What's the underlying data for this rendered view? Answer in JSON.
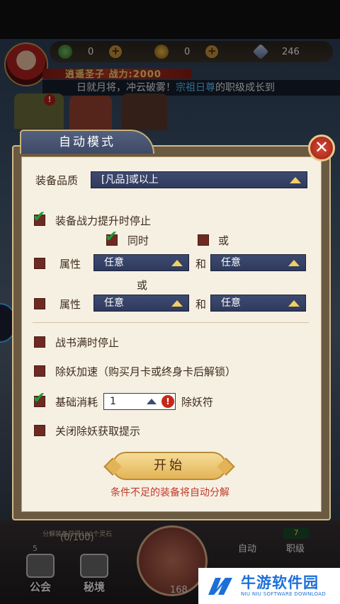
{
  "game": {
    "resources": [
      {
        "icon": "green-coin-icon",
        "value": "0"
      },
      {
        "icon": "gold-coin-icon",
        "value": "0"
      },
      {
        "icon": "crystal-icon",
        "value": "246"
      }
    ],
    "player_name": "逍遥圣子  战力:2000",
    "marquee_prefix": "日就月将，冲云破雾！",
    "marquee_highlight": "宗祖日尊",
    "marquee_suffix": "的职级成长到",
    "alert_badge": "!",
    "progress_label": "分解装备获得100个灵石",
    "progress_value": "(0/100)",
    "counter_5": "5",
    "circle_value": "168",
    "bottom_buttons": [
      {
        "label": "公会",
        "icon": "guild-icon"
      },
      {
        "label": "秘境",
        "icon": "secret-realm-icon"
      }
    ],
    "auto_label": "自动",
    "rank_label": "职级",
    "rank_badge": "7"
  },
  "dialog": {
    "title": "自动模式",
    "close_symbol": "✕",
    "quality_label": "装备品质",
    "quality_value": "[凡品]或以上",
    "stop_on_power": {
      "label": "装备战力提升时停止",
      "checked": true
    },
    "same_time": {
      "label": "同时",
      "checked": true
    },
    "or_option": {
      "label": "或",
      "checked": false
    },
    "attr_row1": {
      "label": "属性",
      "checked": false,
      "select1": "任意",
      "and": "和",
      "select2": "任意"
    },
    "or_text": "或",
    "attr_row2": {
      "label": "属性",
      "checked": false,
      "select1": "任意",
      "and": "和",
      "select2": "任意"
    },
    "stop_battle_book": {
      "label": "战书满时停止",
      "checked": false
    },
    "speedup": {
      "label": "除妖加速（购买月卡或终身卡后解锁）",
      "checked": false
    },
    "base_consume": {
      "label": "基础消耗",
      "checked": true,
      "value": "1",
      "unit": "除妖符",
      "warn": "!"
    },
    "close_tips": {
      "label": "关闭除妖获取提示",
      "checked": false
    },
    "start_button": "开始",
    "footnote": "条件不足的装备将自动分解"
  },
  "watermark": {
    "title": "牛游软件园",
    "subtitle": "NIU NIU SOFTWARE DOWNLOAD",
    "color": "#1d6fd8"
  },
  "colors": {
    "accent_checkbox": "#6e2a22",
    "check_mark": "#1b9e35",
    "select_bg": "#2f3a5d",
    "select_arrow": "#f2cf62",
    "footnote": "#c0392b"
  }
}
